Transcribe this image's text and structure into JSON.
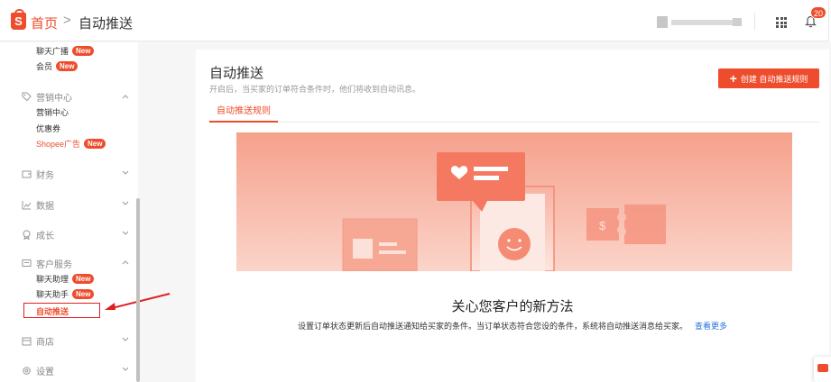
{
  "header": {
    "logo_letter": "S",
    "breadcrumb_home": "首页",
    "breadcrumb_separator": ">",
    "breadcrumb_current": "自动推送",
    "notification_count": "20"
  },
  "sidebar": {
    "items_top": [
      {
        "label": "聊天广播",
        "badge": "New"
      },
      {
        "label": "会员",
        "badge": "New"
      }
    ],
    "marketing": {
      "label": "营销中心",
      "items": [
        {
          "label": "营销中心"
        },
        {
          "label": "优惠券"
        },
        {
          "label": "Shopee广告",
          "badge": "New"
        }
      ]
    },
    "finance": {
      "label": "财务"
    },
    "data": {
      "label": "数据"
    },
    "growth": {
      "label": "成长"
    },
    "customer_service": {
      "label": "客户服务",
      "items": [
        {
          "label": "聊天助理",
          "badge": "New"
        },
        {
          "label": "聊天助手",
          "badge": "New"
        },
        {
          "label": "自动推送"
        }
      ]
    },
    "shop": {
      "label": "商店"
    },
    "settings": {
      "label": "设置"
    }
  },
  "main": {
    "title": "自动推送",
    "subtitle": "开启后，当买家的订单符合条件时，他们将收到自动讯息。",
    "create_button": "创建 自动推送规则",
    "tabs": [
      {
        "label": "自动推送规则",
        "active": true
      }
    ],
    "empty_title": "关心您客户的新方法",
    "empty_description": "设置订单状态更新后自动推送通知给买家的条件。当订单状态符合您设的条件，系统将自动推送消息给买家。",
    "learn_more": "查看更多",
    "illustration_currency": "$"
  },
  "colors": {
    "brand": "#ee4d2d",
    "link": "#2673dd",
    "annotation": "#e02020"
  }
}
